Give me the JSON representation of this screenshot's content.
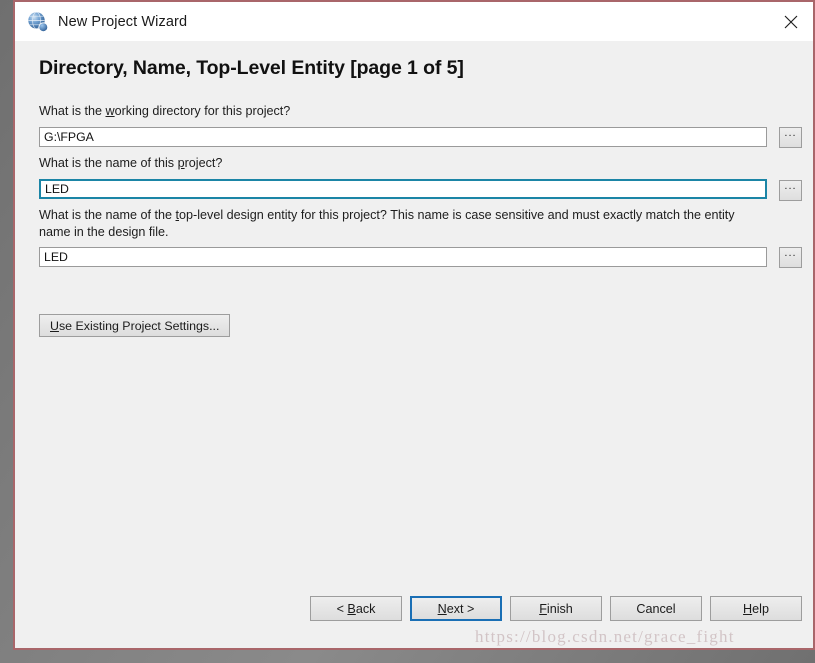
{
  "window": {
    "title": "New Project Wizard",
    "app_icon": "quartus-globe-icon",
    "close_label": "✕",
    "border_color": "#a9666a",
    "titlebar_bg": "#ffffff",
    "body_bg": "#f0f0f0"
  },
  "page": {
    "heading": "Directory, Name, Top-Level Entity [page 1 of 5]",
    "page_number": 1,
    "page_total": 5
  },
  "fields": [
    {
      "label_pre": "What is the ",
      "label_mnemonic": "w",
      "label_post": "orking directory for this project?",
      "label_full": "What is the working directory for this project?",
      "value": "G:\\FPGA",
      "placeholder": "",
      "focused": false,
      "browse_label": "..."
    },
    {
      "label_pre": "What is the name of this ",
      "label_mnemonic": "p",
      "label_post": "roject?",
      "label_full": "What is the name of this project?",
      "value": "LED",
      "placeholder": "",
      "focused": true,
      "browse_label": "..."
    },
    {
      "label_pre": "What is the name of the ",
      "label_mnemonic": "t",
      "label_post": "op-level design entity for this project? This name is case sensitive and must exactly match the entity name in the design file.",
      "label_full": "What is the name of the top-level design entity for this project? This name is case sensitive and must exactly match the entity name in the design file.",
      "value": "LED",
      "placeholder": "",
      "focused": false,
      "browse_label": "..."
    }
  ],
  "use_existing": {
    "mnemonic": "U",
    "rest": "se Existing Project Settings...",
    "full": "Use Existing Project Settings..."
  },
  "footer": {
    "buttons": [
      {
        "pre": "< ",
        "mnemonic": "B",
        "post": "ack",
        "full": "< Back",
        "focused": false
      },
      {
        "pre": "",
        "mnemonic": "N",
        "post": "ext >",
        "full": "Next >",
        "focused": true
      },
      {
        "pre": "",
        "mnemonic": "F",
        "post": "inish",
        "full": "Finish",
        "focused": false
      },
      {
        "pre": "",
        "mnemonic": "",
        "post": "Cancel",
        "full": "Cancel",
        "focused": false
      },
      {
        "pre": "",
        "mnemonic": "H",
        "post": "elp",
        "full": "Help",
        "focused": false
      }
    ]
  },
  "watermark": {
    "text": "https://blog.csdn.net/grace_fight"
  },
  "colors": {
    "focus_input_border": "#1b85a6",
    "focus_button_border": "#1a6fb5",
    "window_border": "#a9666a",
    "dialog_bg": "#f0f0f0"
  }
}
